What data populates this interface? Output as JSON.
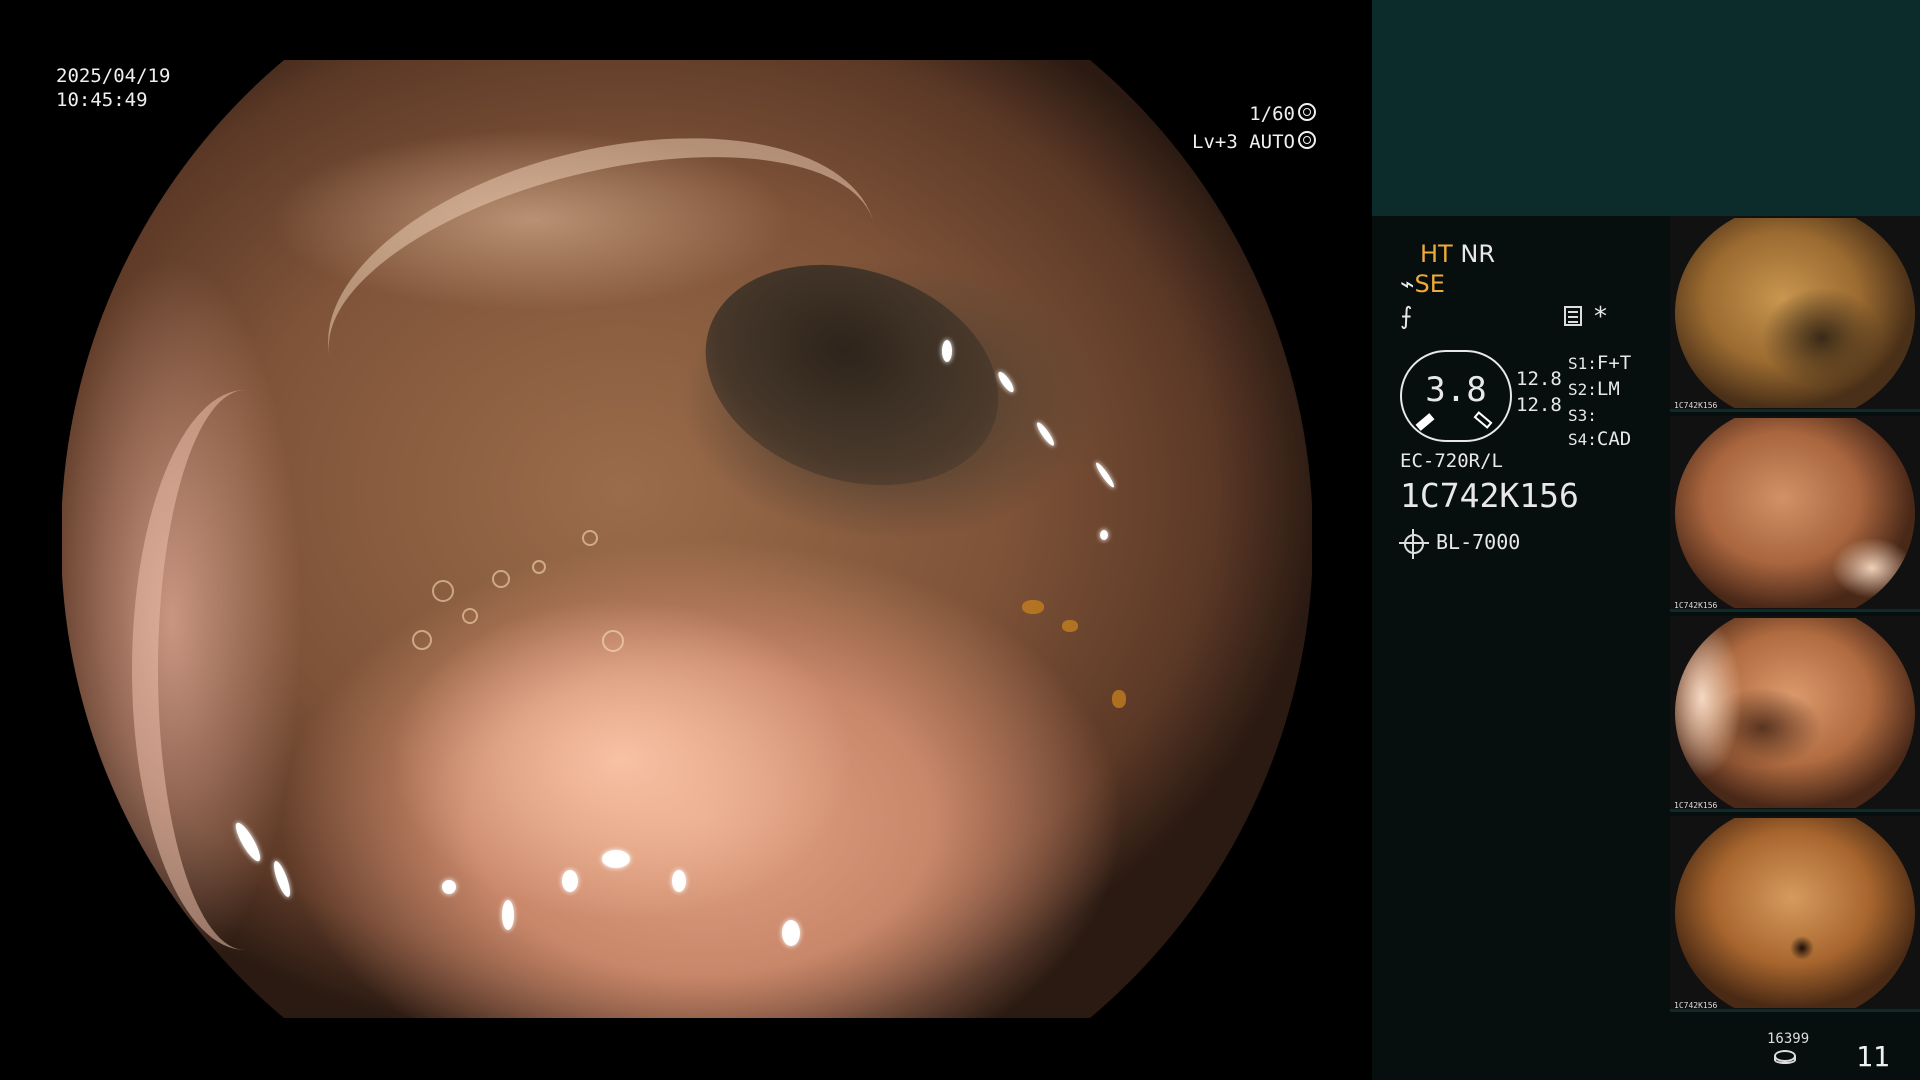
{
  "main_view": {
    "date": "2025/04/19",
    "time": "10:45:49",
    "shutter": "1/60",
    "level": "Lv+3",
    "mode": "AUTO",
    "shutter_icon": "aperture-icon",
    "mode_icon": "circle-icon"
  },
  "status_panel": {
    "ht": "HT",
    "nr": "NR",
    "se": "SE",
    "se_icon": "tool-icon",
    "line3_icon": "function-icon",
    "rec_icon": "document-icon",
    "asterisk": "*",
    "gauge_value": "3.8",
    "pressure_1": "12.8",
    "pressure_2": "12.8",
    "s1_key": "S1:",
    "s1_val": "F+T",
    "s2_key": "S2:",
    "s2_val": "LM",
    "s3_key": "S3:",
    "s3_val": "",
    "s4_key": "S4:",
    "s4_val": "CAD",
    "scope_model": "EC-720R/L",
    "scope_serial": "1C742K156",
    "light_icon": "light-bulb-icon",
    "light_source": "BL-7000"
  },
  "thumbnails": [
    {
      "label": "1C742K156"
    },
    {
      "label": "1C742K156"
    },
    {
      "label": "1C742K156"
    },
    {
      "label": "1C742K156"
    }
  ],
  "footer": {
    "storage_count": "16399",
    "storage_icon": "disk-icon",
    "image_count": "11"
  },
  "colors": {
    "accent_orange": "#f2a93b",
    "panel_teal": "#0c2b2b",
    "panel_dark": "#060e0e"
  }
}
